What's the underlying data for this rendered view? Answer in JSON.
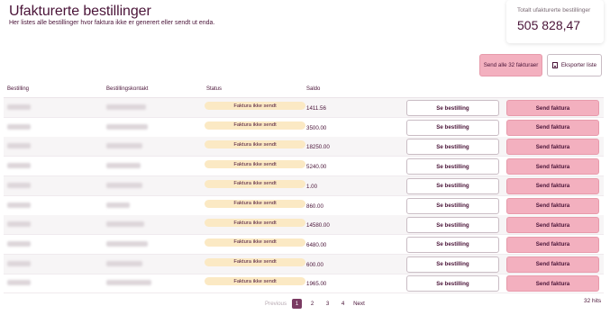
{
  "header": {
    "title": "Ufakturerte bestillinger",
    "subtitle": "Her listes alle bestillinger hvor faktura ikke er generert eller sendt ut enda."
  },
  "total": {
    "label": "Totalt ufakturerte bestillinger",
    "value": "505 828,47"
  },
  "actions": {
    "send_all_label": "Send alle 32 fakturaer",
    "export_label": "Eksporter liste"
  },
  "table": {
    "columns": [
      "Bestilling",
      "Bestillingskontakt",
      "Status",
      "Saldo"
    ],
    "see_label": "Se bestilling",
    "send_label": "Send faktura",
    "rows": [
      {
        "status": "Faktura ikke sendt",
        "saldo": "1411.56"
      },
      {
        "status": "Faktura ikke sendt",
        "saldo": "3500.00"
      },
      {
        "status": "Faktura ikke sendt",
        "saldo": "18250.00"
      },
      {
        "status": "Faktura ikke sendt",
        "saldo": "5240.00"
      },
      {
        "status": "Faktura ikke sendt",
        "saldo": "1.00"
      },
      {
        "status": "Faktura ikke sendt",
        "saldo": "860.00"
      },
      {
        "status": "Faktura ikke sendt",
        "saldo": "14580.00"
      },
      {
        "status": "Faktura ikke sendt",
        "saldo": "6480.00"
      },
      {
        "status": "Faktura ikke sendt",
        "saldo": "600.00"
      },
      {
        "status": "Faktura ikke sendt",
        "saldo": "1965.00"
      }
    ]
  },
  "pagination": {
    "prev_label": "Previous",
    "pages": [
      "1",
      "2",
      "3",
      "4"
    ],
    "active_page": "1",
    "next_label": "Next"
  },
  "hits": "32 hits",
  "colors": {
    "accent_pink": "#f3b0bf",
    "status_yellow": "#fbe9c4",
    "text_plum": "#4a1438",
    "active_page": "#7a3a62"
  }
}
